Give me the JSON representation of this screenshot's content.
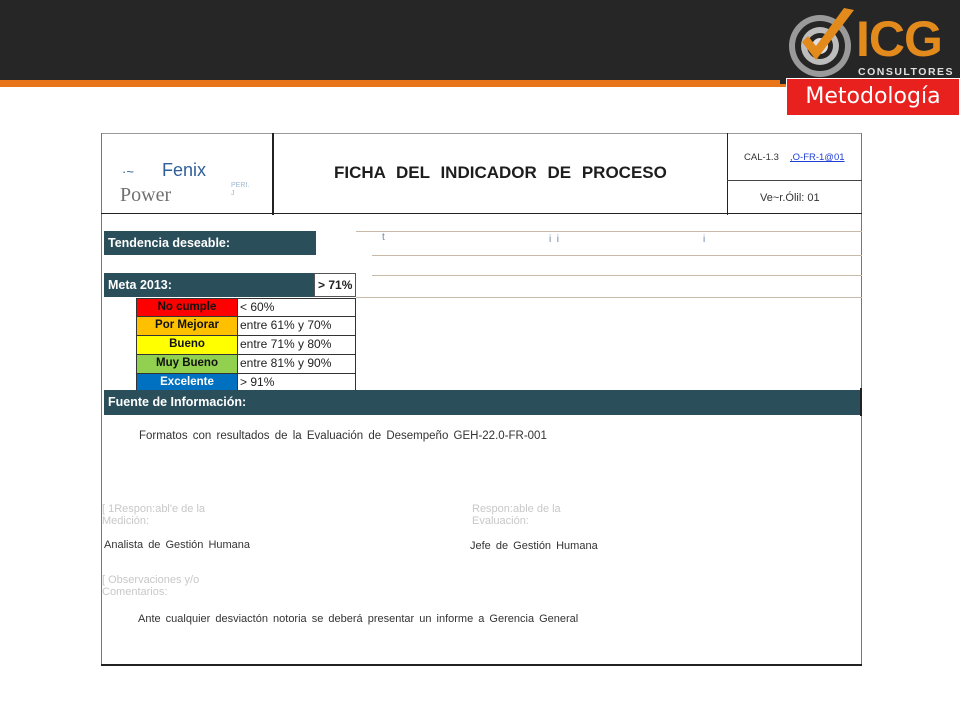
{
  "brand": {
    "name": "ICG",
    "subtitle": "CONSULTORES",
    "section_badge": "Metodología",
    "accent_orange": "#e8751a",
    "badge_red": "#e8211f"
  },
  "header": {
    "company_mark": "·~",
    "company_name": "Fenix",
    "company_sub": "Power",
    "peri_note": "PERI.\nJ",
    "title": "FICHA DEL INDICADOR DE PROCESO",
    "code_label": "CAL-1.3",
    "code_link": ",O-FR-1@01",
    "version_label": "Ve~r.Ólil: 01"
  },
  "sections": {
    "trend_label": "Tendencia deseable:",
    "trend_marks": [
      "t",
      "i  i",
      "i"
    ],
    "goal_label": "Meta 2013:",
    "goal_value": "> 71%",
    "source_label": "Fuente de Información:",
    "source_text": "Formatos con resultados de la Evaluación de Desempeño GEH-22.0-FR-001",
    "section_color": "#2a4f5b"
  },
  "scale": [
    {
      "label": "No cumple",
      "range": "< 60%",
      "color": "#ff0000"
    },
    {
      "label": "Por Mejorar",
      "range": "entre 61% y 70%",
      "color": "#ffc000"
    },
    {
      "label": "Bueno",
      "range": "entre 71% y 80%",
      "color": "#ffff00"
    },
    {
      "label": "Muy Bueno",
      "range": "entre 81% y 90%",
      "color": "#92d050"
    },
    {
      "label": "Excelente",
      "range": "> 91%",
      "color": "#0070c0"
    }
  ],
  "responsibles": {
    "measure_label": "[ 1Respon:abl'e de la\nMedición:",
    "measure_value": "Analista de Gestión Humana",
    "eval_label": "Respon:able de la\nEvaluación:",
    "eval_value": "Jefe de Gestión Humana"
  },
  "observations": {
    "label": "[ Observaciones y/o\nComentarios:",
    "text": "Ante cualquier desviactón notoria se deberá presentar un informe a Gerencia General"
  }
}
